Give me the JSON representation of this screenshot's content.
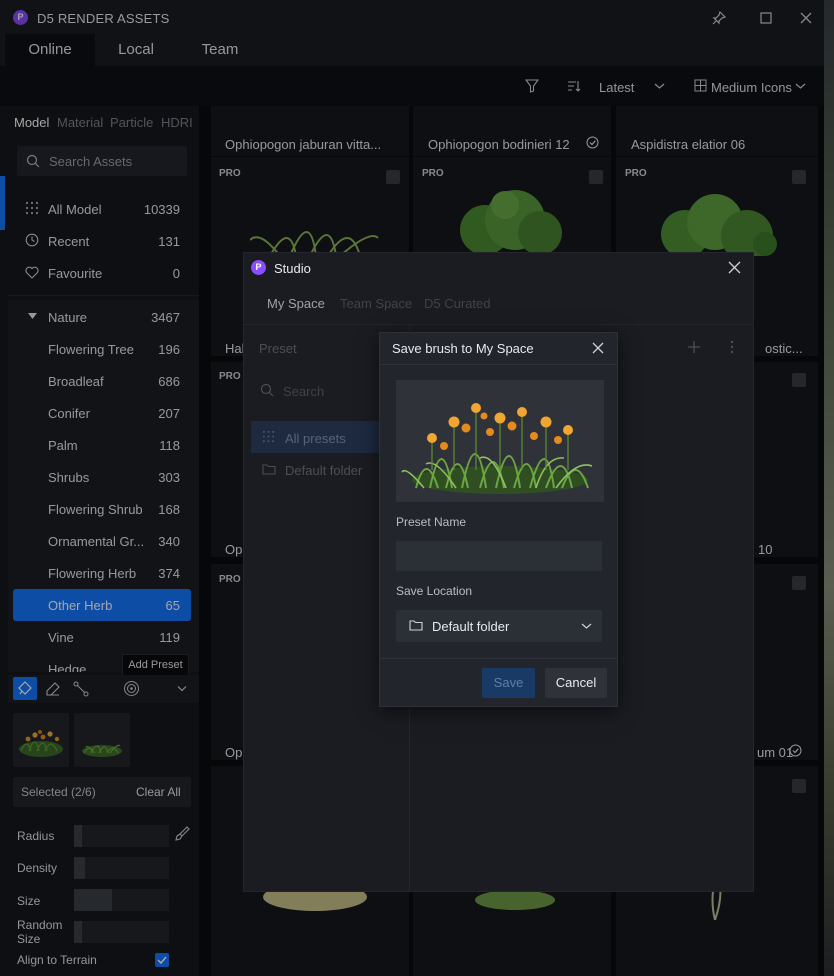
{
  "window": {
    "title": "D5 RENDER ASSETS",
    "logo": "P"
  },
  "tabs": [
    "Online",
    "Local",
    "Team"
  ],
  "toolbar": {
    "sort_label": "Latest",
    "view_label": "Medium Icons"
  },
  "sidebar": {
    "subtabs": [
      "Model",
      "Material",
      "Particle",
      "HDRI"
    ],
    "search_placeholder": "Search Assets",
    "top_items": [
      {
        "label": "All Model",
        "count": "10339",
        "icon": "grid-dots-icon"
      },
      {
        "label": "Recent",
        "count": "131",
        "icon": "clock-icon"
      },
      {
        "label": "Favourite",
        "count": "0",
        "icon": "heart-icon"
      }
    ],
    "group": {
      "label": "Nature",
      "count": "3467"
    },
    "categories": [
      {
        "label": "Flowering Tree",
        "count": "196"
      },
      {
        "label": "Broadleaf",
        "count": "686"
      },
      {
        "label": "Conifer",
        "count": "207"
      },
      {
        "label": "Palm",
        "count": "118"
      },
      {
        "label": "Shrubs",
        "count": "303"
      },
      {
        "label": "Flowering Shrub",
        "count": "168"
      },
      {
        "label": "Ornamental Gr...",
        "count": "340"
      },
      {
        "label": "Flowering Herb",
        "count": "374"
      },
      {
        "label": "Other Herb",
        "count": "65"
      },
      {
        "label": "Vine",
        "count": "119"
      },
      {
        "label": "Hedge",
        "count": ""
      }
    ],
    "tooltip": "Add Preset",
    "selected_label": "Selected (2/6)",
    "clear_all": "Clear All",
    "params": [
      {
        "label": "Radius",
        "level": 0.08
      },
      {
        "label": "Density",
        "level": 0.12
      },
      {
        "label": "Size",
        "level": 0.4
      },
      {
        "label": "Random Size",
        "level": 0.08
      }
    ],
    "align_label": "Align to Terrain",
    "align_checked": true
  },
  "grid": {
    "row1": [
      {
        "title": "Ophiopogon jaburan vitta...",
        "checked": false
      },
      {
        "title": "Ophiopogon bodinieri 12",
        "checked": true
      },
      {
        "title": "Aspidistra elatior 06",
        "checked": false
      }
    ],
    "pro": "PRO",
    "partial_titles": [
      "Hal",
      "ostic...",
      "Opl",
      "10",
      "Opl",
      "um 01"
    ]
  },
  "studio": {
    "logo": "P",
    "title": "Studio",
    "tabs": [
      "My Space",
      "Team Space",
      "D5 Curated"
    ],
    "preset_label": "Preset",
    "search_placeholder": "Search",
    "folders": [
      {
        "label": "All presets",
        "icon": "grid-dots-icon"
      },
      {
        "label": "Default folder",
        "icon": "folder-icon"
      }
    ]
  },
  "save_dialog": {
    "title": "Save brush to My Space",
    "preset_name_label": "Preset Name",
    "preset_name_value": "",
    "location_label": "Save Location",
    "location_value": "Default folder",
    "save": "Save",
    "cancel": "Cancel"
  },
  "colors": {
    "accent": "#1677ff",
    "logo": "#8a4dff"
  }
}
